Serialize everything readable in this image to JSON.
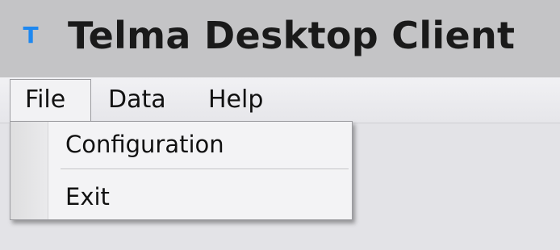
{
  "window": {
    "title": "Telma Desktop Client",
    "icon_letter": "T",
    "icon_name": "app-icon",
    "icon_color": "#1e88f0"
  },
  "menubar": {
    "items": [
      {
        "label": "File",
        "open": true
      },
      {
        "label": "Data"
      },
      {
        "label": "Help"
      }
    ]
  },
  "file_menu": {
    "items": [
      {
        "label": "Configuration"
      },
      {
        "label": "Exit"
      }
    ]
  }
}
